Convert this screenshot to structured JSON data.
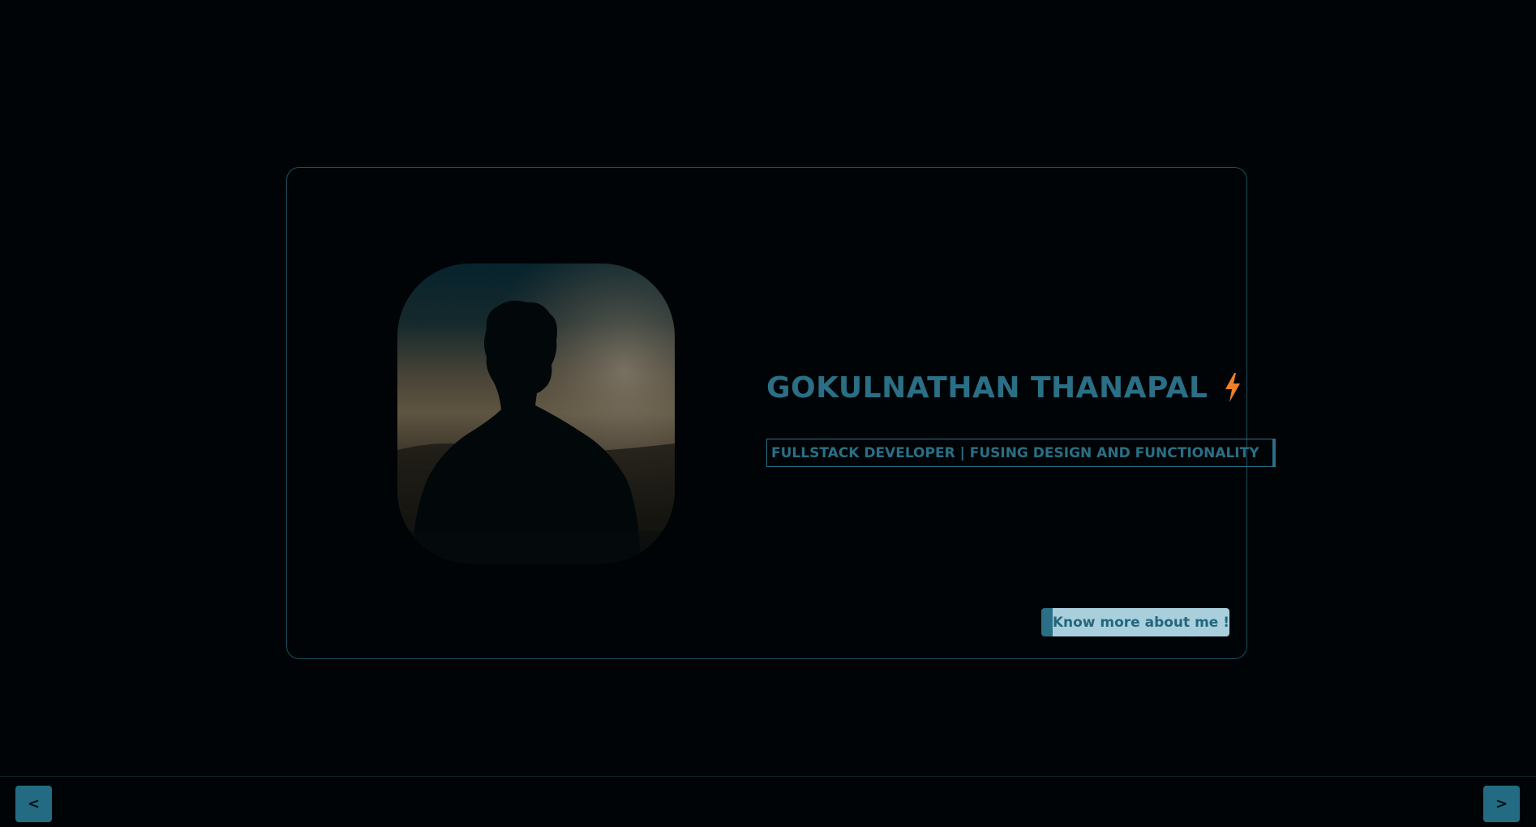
{
  "hero": {
    "name": "GOKULNATHAN THANAPAL",
    "name_icon": "lightning-bolt-icon",
    "tagline": "FULLSTACK DEVELOPER | FUSING DESIGN AND FUNCTIONALITY",
    "cta_label": "Know more about me !",
    "portrait": "silhouette-portrait"
  },
  "navigation": {
    "prev_label": "<",
    "next_label": ">"
  },
  "colors": {
    "background": "#010406",
    "accent": "#2a6f85",
    "bolt": "#f07f2a",
    "cta_background": "#a9cfdd"
  }
}
